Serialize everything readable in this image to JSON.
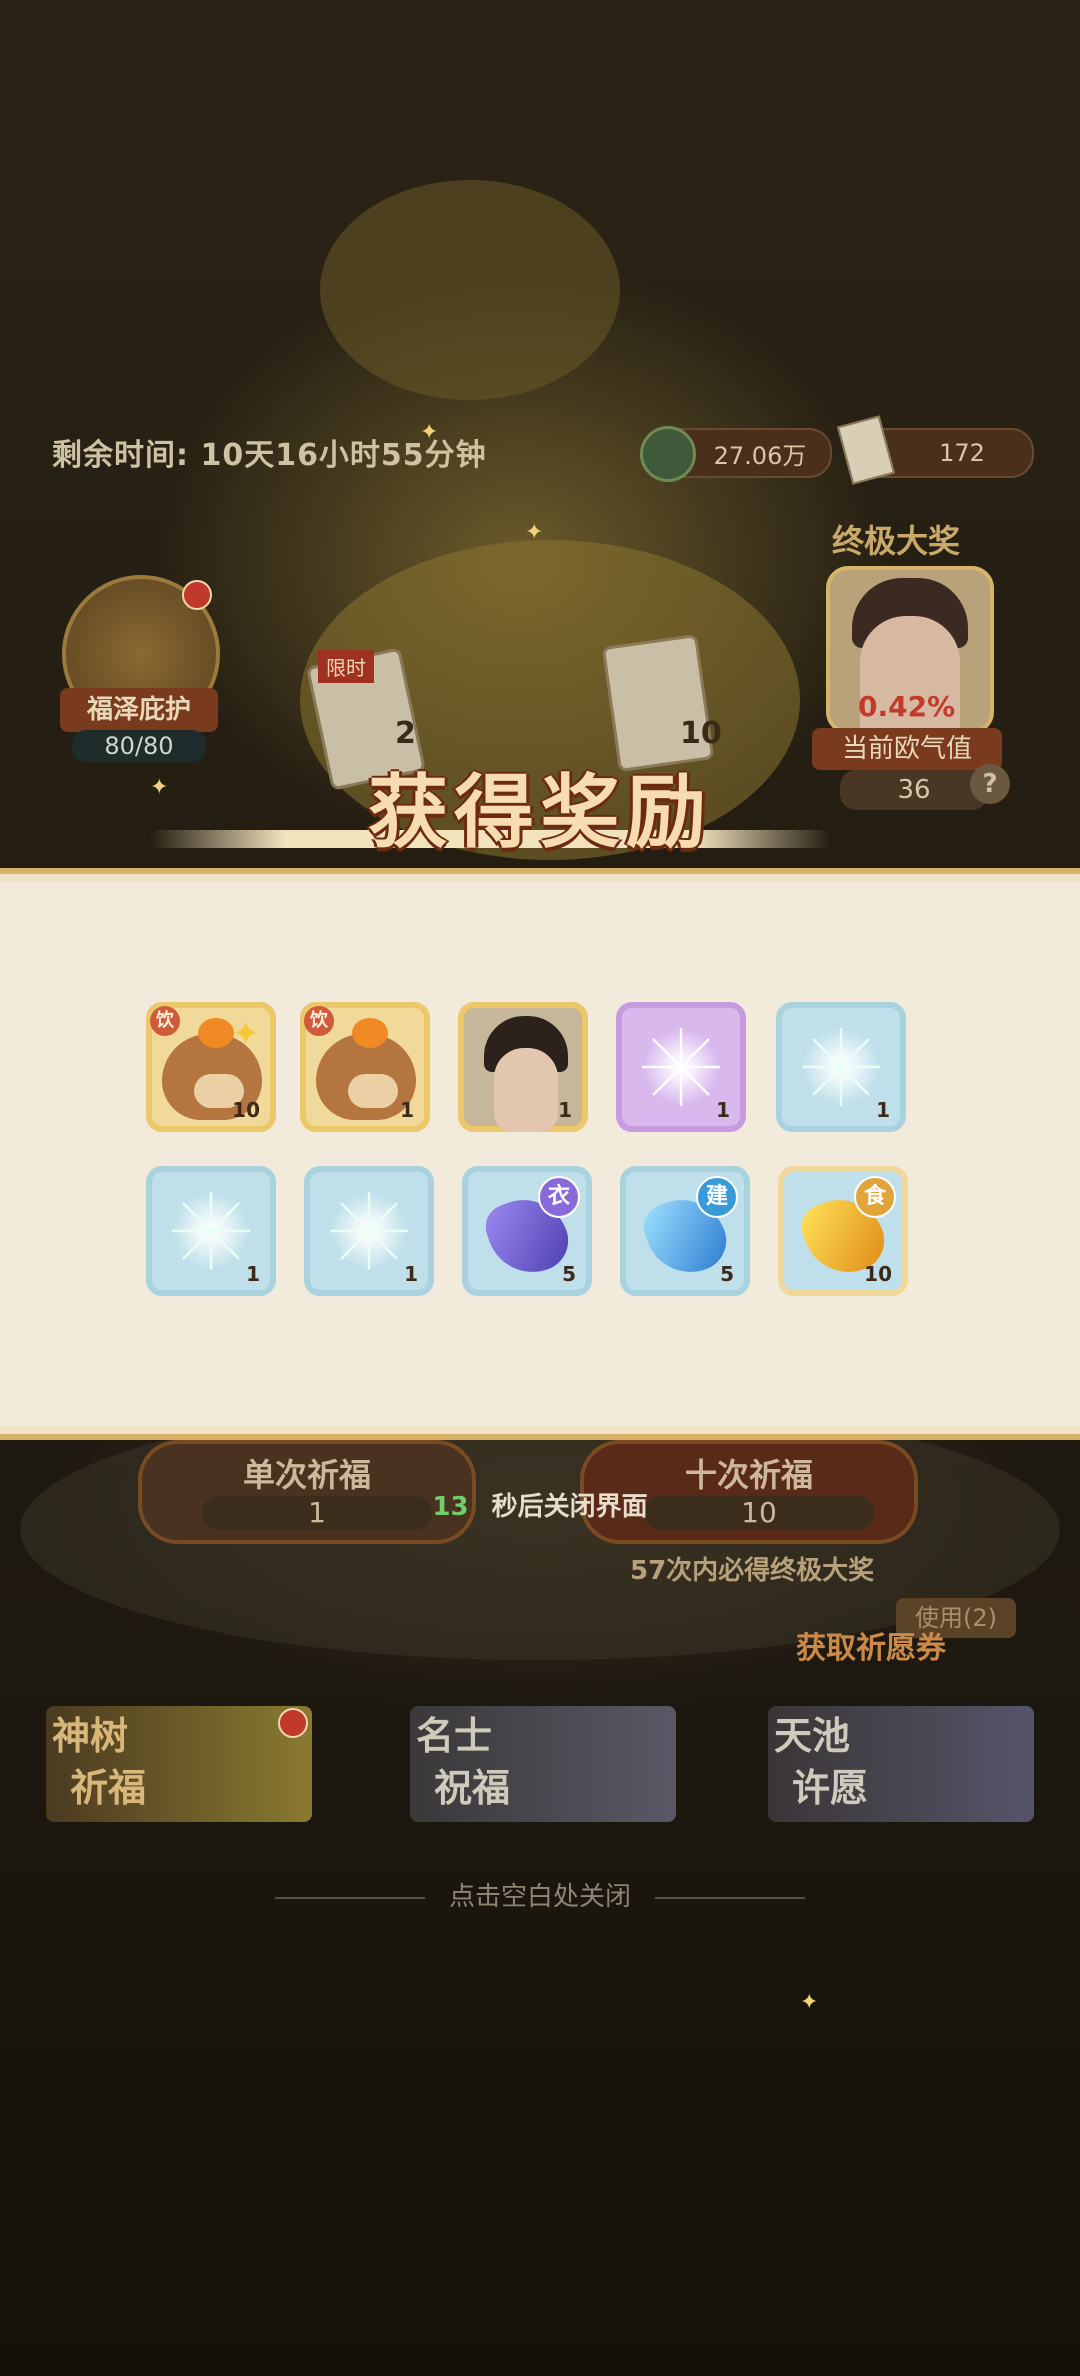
{
  "hud": {
    "timer_text": "剩余时间: 10天16小时55分钟",
    "coins": "27.06万",
    "tickets": "172"
  },
  "left_badge": {
    "label": "福泽庇护",
    "count": "80/80"
  },
  "middle_cards": {
    "limited_label": "限时",
    "card1_count": "2",
    "card2_count": "10"
  },
  "grand_prize": {
    "title": "终极大奖",
    "percent": "0.42%",
    "luck_label": "当前欧气值",
    "luck_value": "36",
    "help": "?"
  },
  "reward_dialog": {
    "title": "获得奖励",
    "items": [
      {
        "name": "bear-drink-item",
        "tag": "饮",
        "qty": "10",
        "style": "gold"
      },
      {
        "name": "bear-drink-item",
        "tag": "饮",
        "qty": "1",
        "style": "gold"
      },
      {
        "name": "character-portrait-item",
        "tag": "",
        "qty": "1",
        "style": "gold"
      },
      {
        "name": "purple-firework-item",
        "tag": "",
        "qty": "1",
        "style": "purple"
      },
      {
        "name": "blue-firework-item",
        "tag": "",
        "qty": "1",
        "style": "blue"
      },
      {
        "name": "blue-firework-item",
        "tag": "",
        "qty": "1",
        "style": "blue"
      },
      {
        "name": "blue-firework-item",
        "tag": "",
        "qty": "1",
        "style": "blue"
      },
      {
        "name": "clothing-gem-item",
        "tag": "衣",
        "qty": "5",
        "style": "blue"
      },
      {
        "name": "building-gem-item",
        "tag": "建",
        "qty": "5",
        "style": "blue"
      },
      {
        "name": "food-gem-item",
        "tag": "食",
        "qty": "10",
        "style": "goldlight"
      }
    ]
  },
  "pray": {
    "single_label": "单次祈福",
    "single_cost": "1",
    "ten_label": "十次祈福",
    "ten_cost": "10",
    "countdown_num": "13",
    "countdown_text": "秒后关闭界面",
    "guarantee": "57次内必得终极大奖",
    "get_ticket": "获取祈愿券",
    "use_label": "使用(2)"
  },
  "tabs": [
    {
      "line1": "神树",
      "line2": "祈福"
    },
    {
      "line1": "名士",
      "line2": "祝福"
    },
    {
      "line1": "天池",
      "line2": "许愿"
    }
  ],
  "close_hint": "点击空白处关闭",
  "colors": {
    "panel_bg": "#f2ebdc",
    "panel_border": "#d9b26a",
    "title_text": "#f6dcb0",
    "countdown_accent": "#6fd06a"
  }
}
